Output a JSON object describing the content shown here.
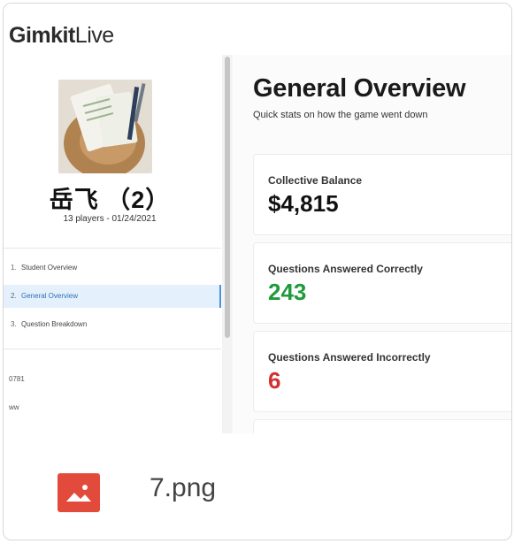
{
  "app": {
    "brand_bold": "Gimkit",
    "brand_light": "Live"
  },
  "sidebar": {
    "player_name": "岳飞 （2）",
    "player_meta": "13 players - 01/24/2021",
    "nav": [
      {
        "num": "1.",
        "label": "Student Overview",
        "active": false
      },
      {
        "num": "2.",
        "label": "General Overview",
        "active": true
      },
      {
        "num": "3.",
        "label": "Question Breakdown",
        "active": false
      }
    ],
    "extra": [
      "0781",
      "ww"
    ]
  },
  "main": {
    "title": "General Overview",
    "subtitle": "Quick stats on how the game went down",
    "stats": [
      {
        "label": "Collective Balance",
        "value": "$4,815",
        "color": "#111111"
      },
      {
        "label": "Questions Answered Correctly",
        "value": "243",
        "color": "#1f9a3c"
      },
      {
        "label": "Questions Answered Incorrectly",
        "value": "6",
        "color": "#d32f2f"
      }
    ]
  },
  "attachment": {
    "file_name": "7.png",
    "icon": "image-file-icon",
    "icon_color": "#e24b3b"
  }
}
